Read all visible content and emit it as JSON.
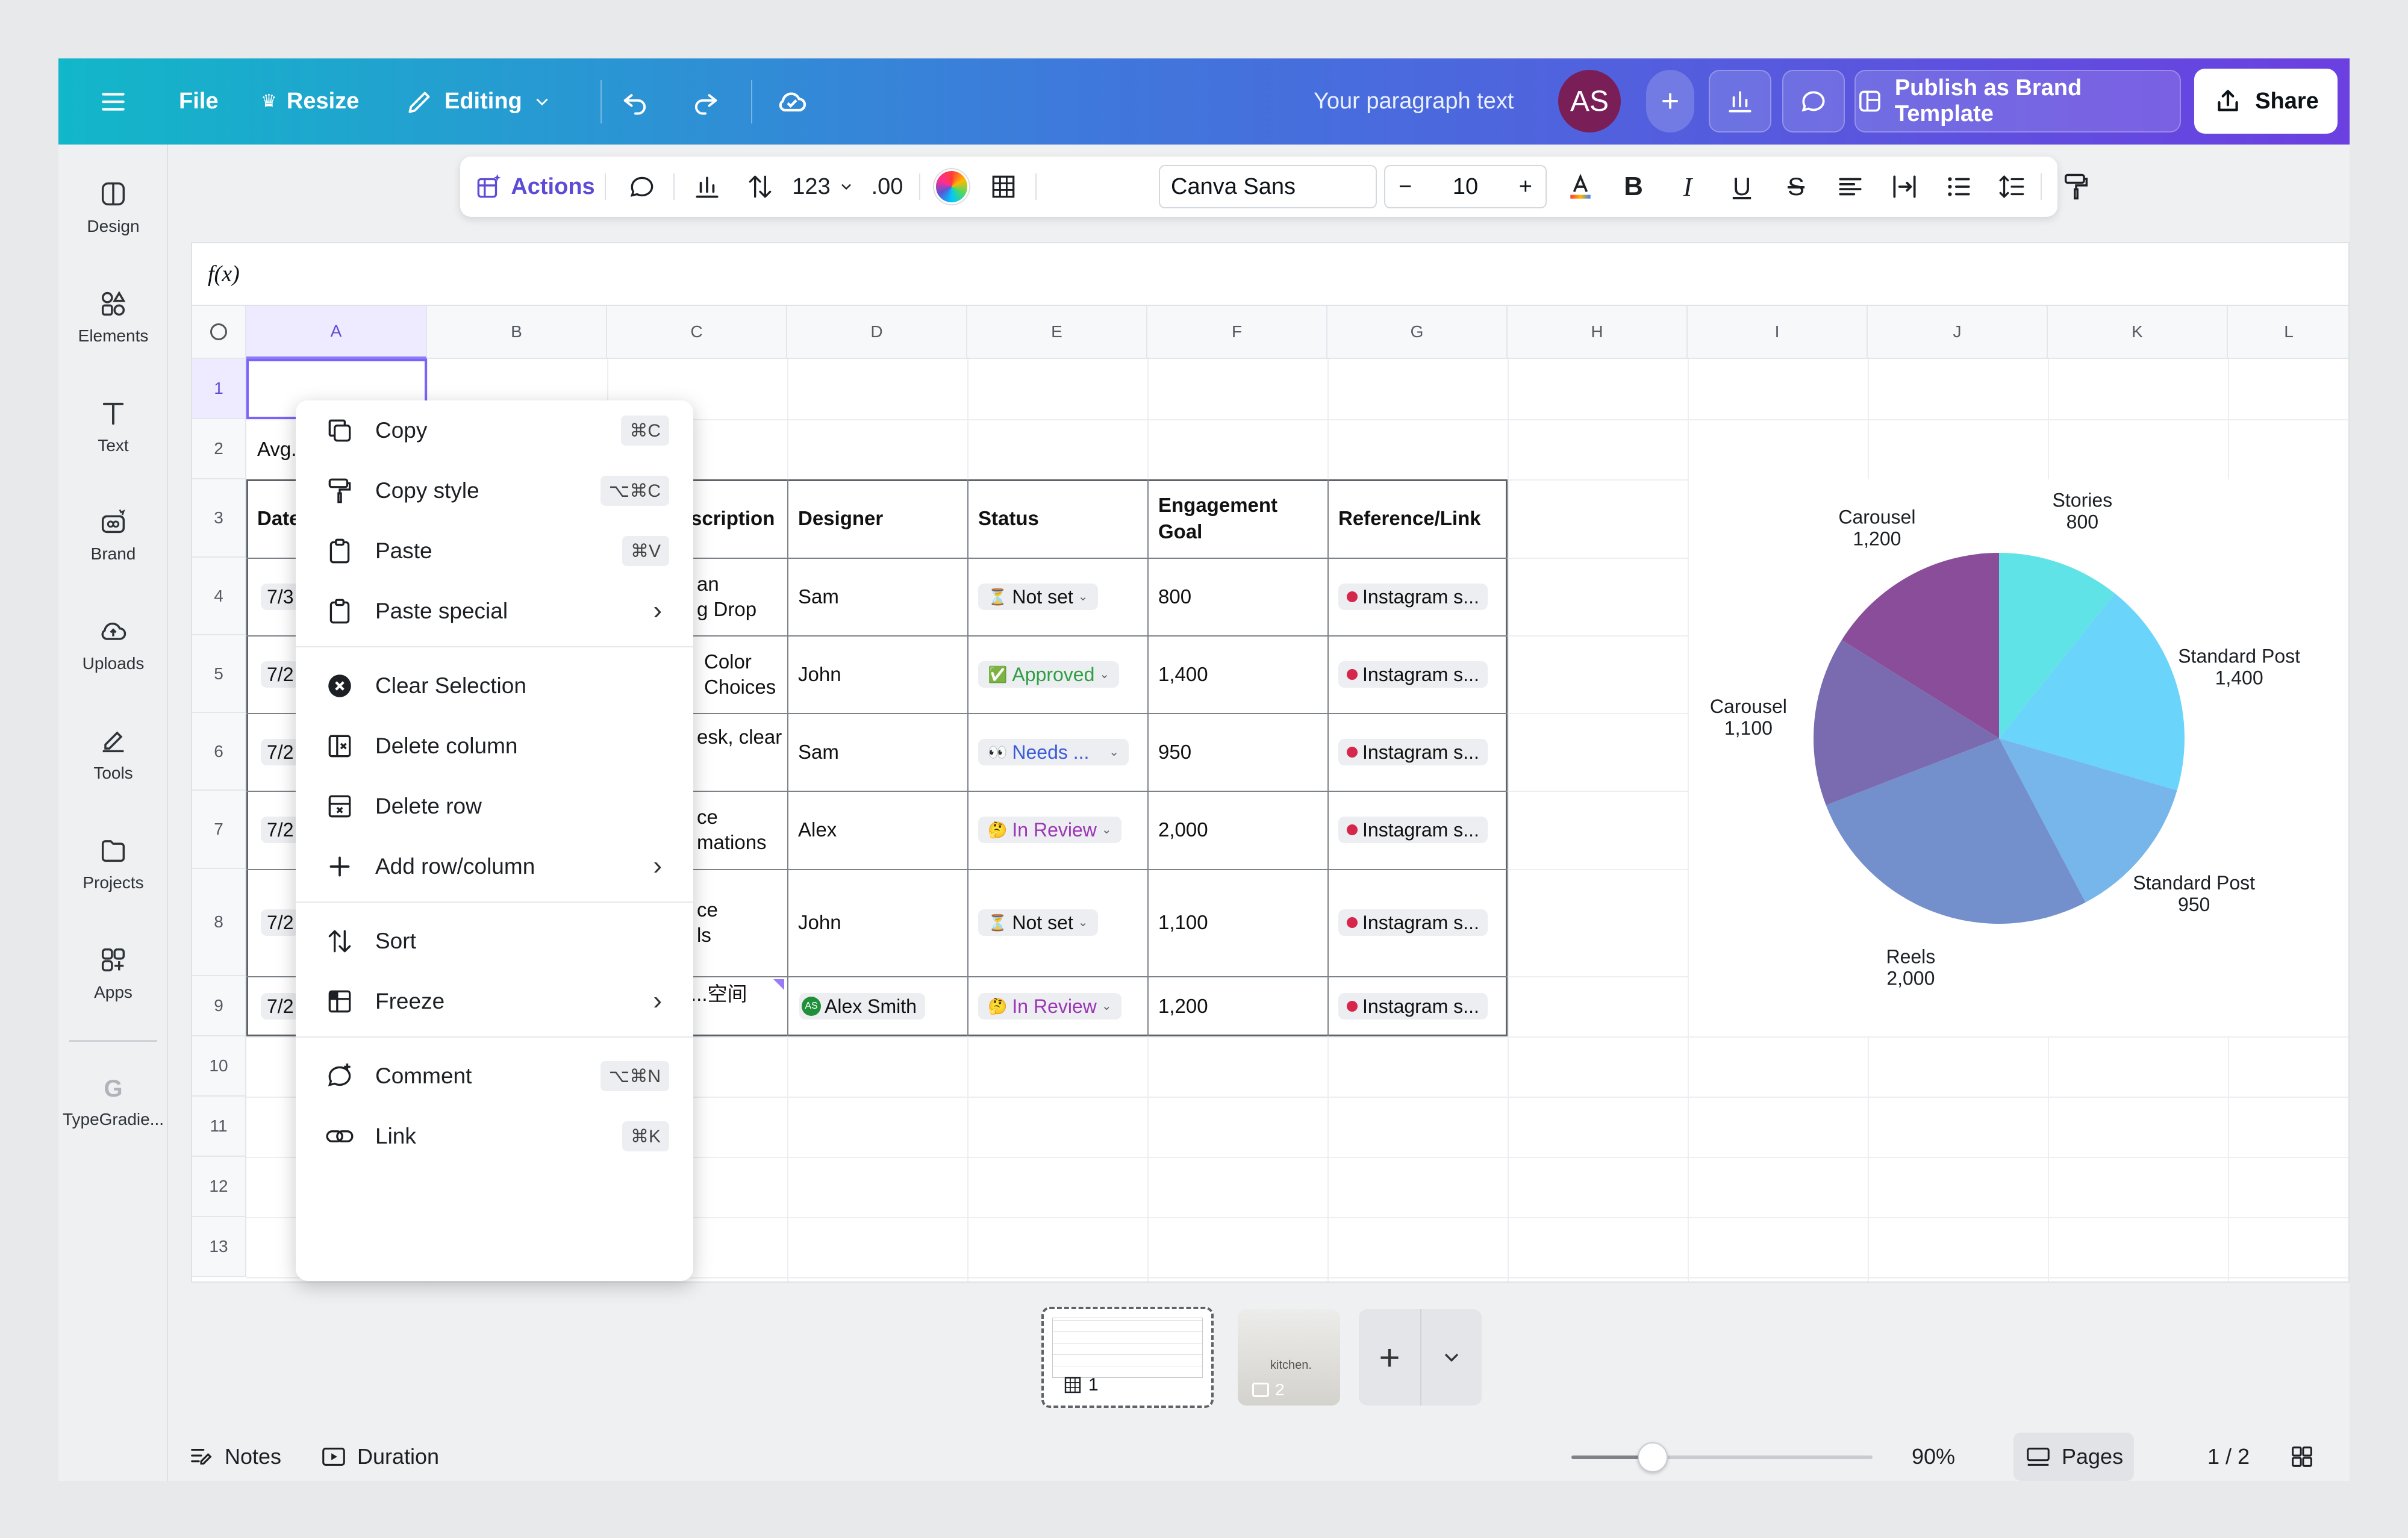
{
  "topbar": {
    "file": "File",
    "resize": "Resize",
    "editing": "Editing",
    "doc_title": "Your paragraph text",
    "avatar": "AS",
    "publish": "Publish as Brand Template",
    "share": "Share"
  },
  "rail": [
    {
      "label": "Design",
      "icon": "design-icon"
    },
    {
      "label": "Elements",
      "icon": "elements-icon"
    },
    {
      "label": "Text",
      "icon": "text-icon"
    },
    {
      "label": "Brand",
      "icon": "brand-icon"
    },
    {
      "label": "Uploads",
      "icon": "uploads-icon"
    },
    {
      "label": "Tools",
      "icon": "tools-icon"
    },
    {
      "label": "Projects",
      "icon": "projects-icon"
    },
    {
      "label": "Apps",
      "icon": "apps-icon"
    },
    {
      "label": "TypeGradie...",
      "icon": "typegradient-icon"
    }
  ],
  "format": {
    "actions": "Actions",
    "number_format": "123",
    "decimal": ".00",
    "font": "Canva Sans",
    "size": "10",
    "minus": "−",
    "plus": "+"
  },
  "sheet": {
    "fx": "f(x)",
    "columns": [
      "A",
      "B",
      "C",
      "D",
      "E",
      "F",
      "G",
      "H",
      "I",
      "J",
      "K",
      "L"
    ],
    "rows": [
      "1",
      "2",
      "3",
      "4",
      "5",
      "6",
      "7",
      "8",
      "9",
      "10",
      "11",
      "12",
      "13"
    ],
    "a2": "Avg.",
    "a_col": [
      "Date",
      "7/3",
      "7/2",
      "7/2",
      "7/2",
      "7/2",
      "7/2"
    ],
    "headers": {
      "description": "scription",
      "designer": "Designer",
      "status": "Status",
      "goal_1": "Engagement",
      "goal_2": "Goal",
      "ref": "Reference/Link"
    },
    "desc": [
      [
        "an",
        "g Drop"
      ],
      [
        "Color",
        "Choices"
      ],
      [
        "esk, clear",
        ""
      ],
      [
        "ce",
        "mations"
      ],
      [
        "ce",
        "ls"
      ],
      [
        "...空间",
        ""
      ]
    ],
    "designers": [
      "Sam",
      "John",
      "Sam",
      "Alex",
      "John",
      "Alex Smith"
    ],
    "designer_badge": "AS",
    "statuses": [
      {
        "emoji": "⏳",
        "text": "Not set",
        "color": "#1c2024"
      },
      {
        "emoji": "✅",
        "text": "Approved",
        "color": "#2f9e44"
      },
      {
        "emoji": "👀",
        "text": "Needs ...",
        "color": "#3b5bdb"
      },
      {
        "emoji": "🤔",
        "text": "In Review",
        "color": "#9c36b5"
      },
      {
        "emoji": "⏳",
        "text": "Not set",
        "color": "#1c2024"
      },
      {
        "emoji": "🤔",
        "text": "In Review",
        "color": "#9c36b5"
      }
    ],
    "goals": [
      "800",
      "1,400",
      "950",
      "2,000",
      "1,100",
      "1,200"
    ],
    "links": [
      "Instagram s...",
      "Instagram s...",
      "Instagram s...",
      "Instagram s...",
      "Instagram s...",
      "Instagram s..."
    ]
  },
  "menu": {
    "items": [
      {
        "label": "Copy",
        "shortcut": "⌘C",
        "icon": "copy-icon"
      },
      {
        "label": "Copy style",
        "shortcut": "⌥⌘C",
        "icon": "paint-roller-icon"
      },
      {
        "label": "Paste",
        "shortcut": "⌘V",
        "icon": "paste-icon"
      },
      {
        "label": "Paste special",
        "icon": "paste-special-icon"
      },
      {
        "label": "Clear Selection",
        "icon": "clear-icon"
      },
      {
        "label": "Delete column",
        "icon": "delete-column-icon"
      },
      {
        "label": "Delete row",
        "icon": "delete-row-icon"
      },
      {
        "label": "Add row/column",
        "icon": "plus-icon"
      },
      {
        "label": "Sort",
        "icon": "sort-icon"
      },
      {
        "label": "Freeze",
        "icon": "freeze-icon"
      },
      {
        "label": "Comment",
        "shortcut": "⌥⌘N",
        "icon": "comment-icon"
      },
      {
        "label": "Link",
        "shortcut": "⌘K",
        "icon": "link-icon"
      }
    ]
  },
  "chart_data": {
    "type": "pie",
    "categories": [
      "Stories",
      "Standard Post",
      "Standard Post",
      "Reels",
      "Carousel",
      "Carousel"
    ],
    "values": [
      800,
      1400,
      950,
      2000,
      1100,
      1200
    ],
    "value_labels": [
      "800",
      "1,400",
      "950",
      "2,000",
      "1,100",
      "1,200"
    ],
    "colors": [
      "#5fe3e6",
      "#6bd4fb",
      "#77b6ea",
      "#7390cc",
      "#7a6bb0",
      "#8a4d99"
    ]
  },
  "bottom": {
    "notes": "Notes",
    "duration": "Duration",
    "zoom": "90%",
    "zoom_fraction": 0.27,
    "pages": "Pages",
    "page_count": "1 / 2",
    "page1": "1",
    "page2": "2",
    "thumb2_text": "kitchen."
  }
}
